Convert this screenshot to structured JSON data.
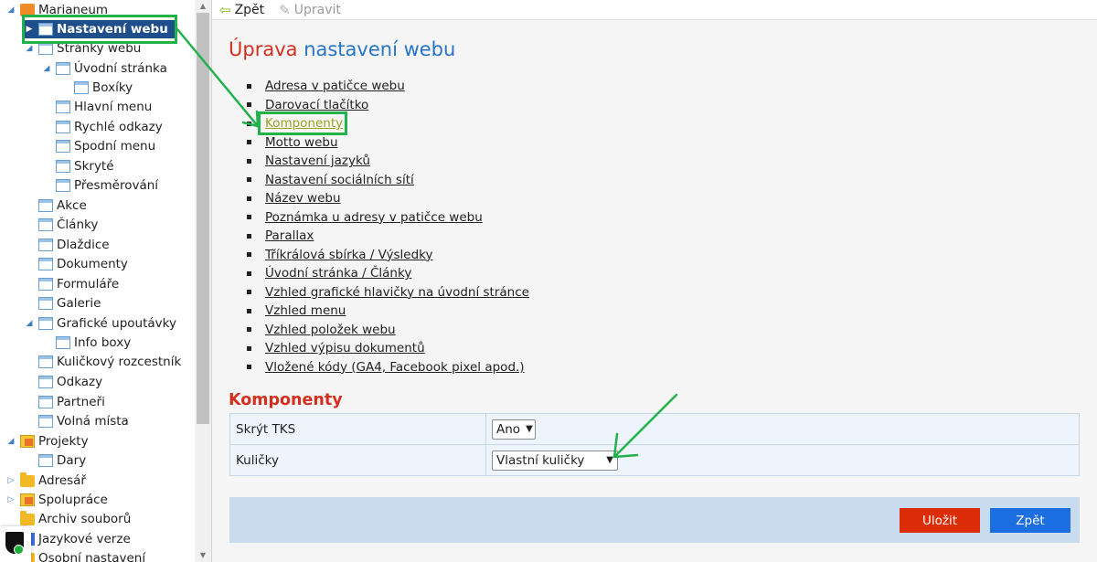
{
  "tree": {
    "items": [
      {
        "label": "Marianeum",
        "icon": "cube-icon"
      },
      {
        "label": "Nastavení webu",
        "icon": "page-icon"
      },
      {
        "label": "Stránky webu",
        "icon": "page-icon"
      },
      {
        "label": "Úvodní stránka",
        "icon": "page-icon"
      },
      {
        "label": "Boxíky",
        "icon": "page-icon"
      },
      {
        "label": "Hlavní menu",
        "icon": "page-icon"
      },
      {
        "label": "Rychlé odkazy",
        "icon": "page-icon"
      },
      {
        "label": "Spodní menu",
        "icon": "page-icon"
      },
      {
        "label": "Skryté",
        "icon": "page-icon"
      },
      {
        "label": "Přesměrování",
        "icon": "page-icon"
      },
      {
        "label": "Akce",
        "icon": "page-icon"
      },
      {
        "label": "Články",
        "icon": "page-icon"
      },
      {
        "label": "Dlaždice",
        "icon": "page-icon"
      },
      {
        "label": "Dokumenty",
        "icon": "page-icon"
      },
      {
        "label": "Formuláře",
        "icon": "page-icon"
      },
      {
        "label": "Galerie",
        "icon": "page-icon"
      },
      {
        "label": "Grafické upoutávky",
        "icon": "page-icon"
      },
      {
        "label": "Info boxy",
        "icon": "page-icon"
      },
      {
        "label": "Kuličkový rozcestník",
        "icon": "page-icon"
      },
      {
        "label": "Odkazy",
        "icon": "page-icon"
      },
      {
        "label": "Partneři",
        "icon": "page-icon"
      },
      {
        "label": "Volná místa",
        "icon": "page-icon"
      },
      {
        "label": "Projekty",
        "icon": "folder-multi-icon"
      },
      {
        "label": "Dary",
        "icon": "page-icon"
      },
      {
        "label": "Adresář",
        "icon": "folder-icon"
      },
      {
        "label": "Spolupráce",
        "icon": "folder-multi-icon"
      },
      {
        "label": "Archiv souborů",
        "icon": "folder-icon"
      },
      {
        "label": "Jazykové verze",
        "icon": "flags-icon"
      },
      {
        "label": "Osobní nastavení",
        "icon": "folder-icon"
      }
    ]
  },
  "toolbar": {
    "back_label": "Zpět",
    "edit_label": "Upravit"
  },
  "main": {
    "title_first": "Úprava",
    "title_rest": "nastavení webu",
    "links": [
      "Adresa v patičce webu",
      "Darovací tlačítko",
      "Komponenty",
      "Motto webu",
      "Nastavení jazyků",
      "Nastavení sociálních sítí",
      "Název webu",
      "Poznámka u adresy v patičce webu",
      "Parallax",
      "Tříkrálová sbírka / Výsledky",
      "Úvodní stránka / Články",
      "Vzhled grafické hlavičky na úvodní stránce",
      "Vzhled menu",
      "Vzhled položek webu",
      "Vzhled výpisu dokumentů",
      "Vložené kódy (GA4, Facebook pixel apod.)"
    ],
    "active_link_index": 2,
    "section_title": "Komponenty",
    "settings": [
      {
        "label": "Skrýt TKS",
        "value": "Ano"
      },
      {
        "label": "Kuličky",
        "value": "Vlastní kuličky"
      }
    ],
    "save_label": "Uložit",
    "back_label": "Zpět"
  },
  "colors": {
    "title_accent_red": "#d32f1e",
    "title_blue": "#2574c8",
    "selected_node_bg": "#1f4f8a",
    "save_button": "#dc2c08",
    "back_button": "#1c6fe0",
    "annotation_green": "#22b24c"
  }
}
